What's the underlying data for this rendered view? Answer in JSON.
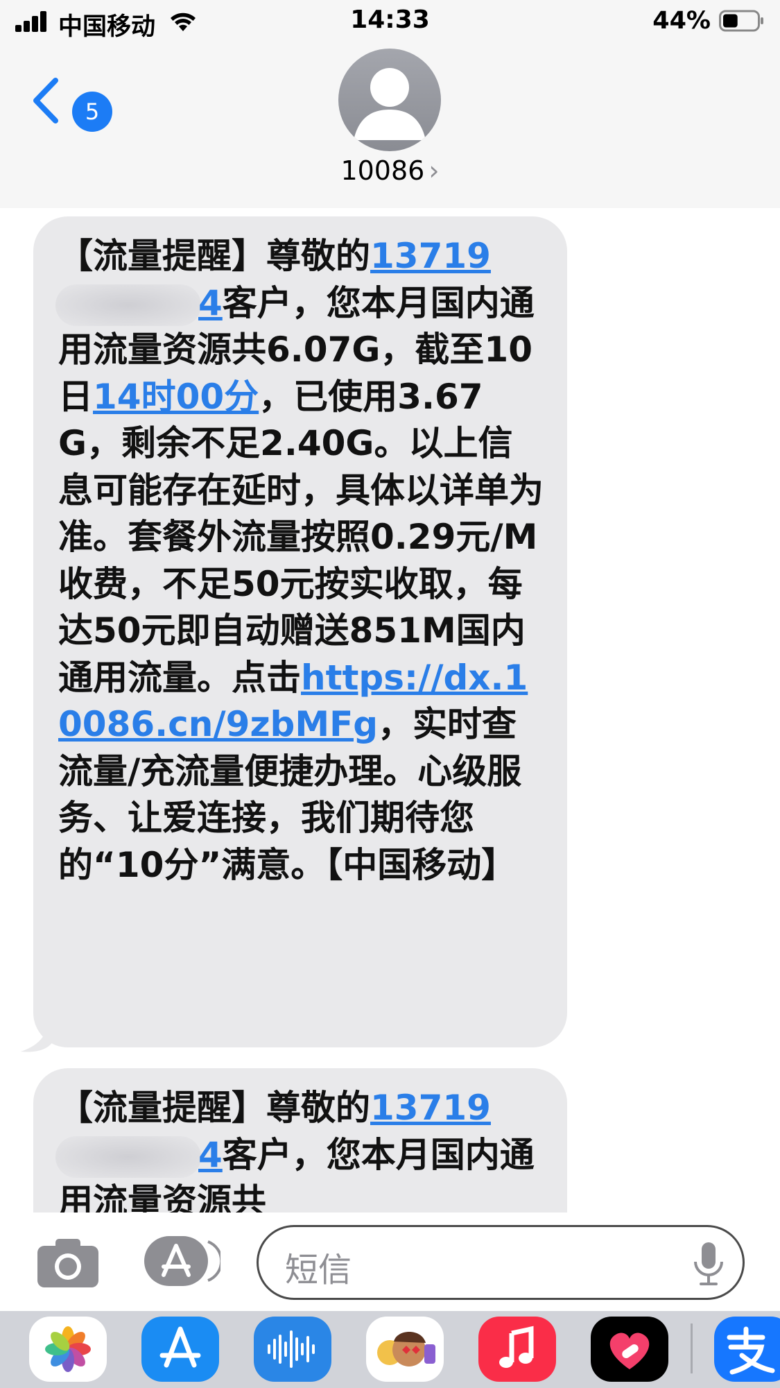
{
  "status_bar": {
    "carrier": "中国移动",
    "time": "14:33",
    "battery_percent": "44%",
    "battery_level": 0.44
  },
  "header": {
    "back_badge": "5",
    "contact_name": "10086",
    "contact_chevron": "›"
  },
  "messages": [
    {
      "prefix": "【流量提醒】尊敬的",
      "phone_visible_start": "13719",
      "phone_visible_end": "4",
      "segment_1": "客户，您本月国内通用流量资源共6.07G，截至10日",
      "time_link": "14时00分",
      "segment_2": "，已使用3.67G，剩余不足2.40G。以上信息可能存在延时，具体以详单为准。套餐外流量按照0.29元/M收费，不足50元按实收取，每达50元即自动赠送851M国内通用流量。点击",
      "url_link": "https://dx.10086.cn/9zbMFg",
      "segment_3": "，实时查流量/充流量便捷办理。心级服务、让爱连接，我们期待您的“10分”满意。【中国移动】"
    },
    {
      "prefix": "【流量提醒】尊敬的",
      "phone_visible_start": "13719",
      "phone_visible_end": "4",
      "segment_1": "客户，您本月国内通用流量资源共"
    }
  ],
  "input": {
    "placeholder": "短信"
  },
  "icons": {
    "camera": "camera-icon",
    "appstore": "app-store-icon",
    "mic": "microphone-icon",
    "drawer": [
      "photos-icon",
      "app-store-icon",
      "audio-message-icon",
      "memoji-icon",
      "music-icon",
      "digital-touch-icon",
      "alipay-icon"
    ]
  },
  "colors": {
    "accent": "#1c7cf5",
    "link": "#2a7ee8",
    "bubble": "#e9e9eb",
    "header_bg": "#f6f6f6",
    "drawer_bg": "#d1d3d9"
  }
}
